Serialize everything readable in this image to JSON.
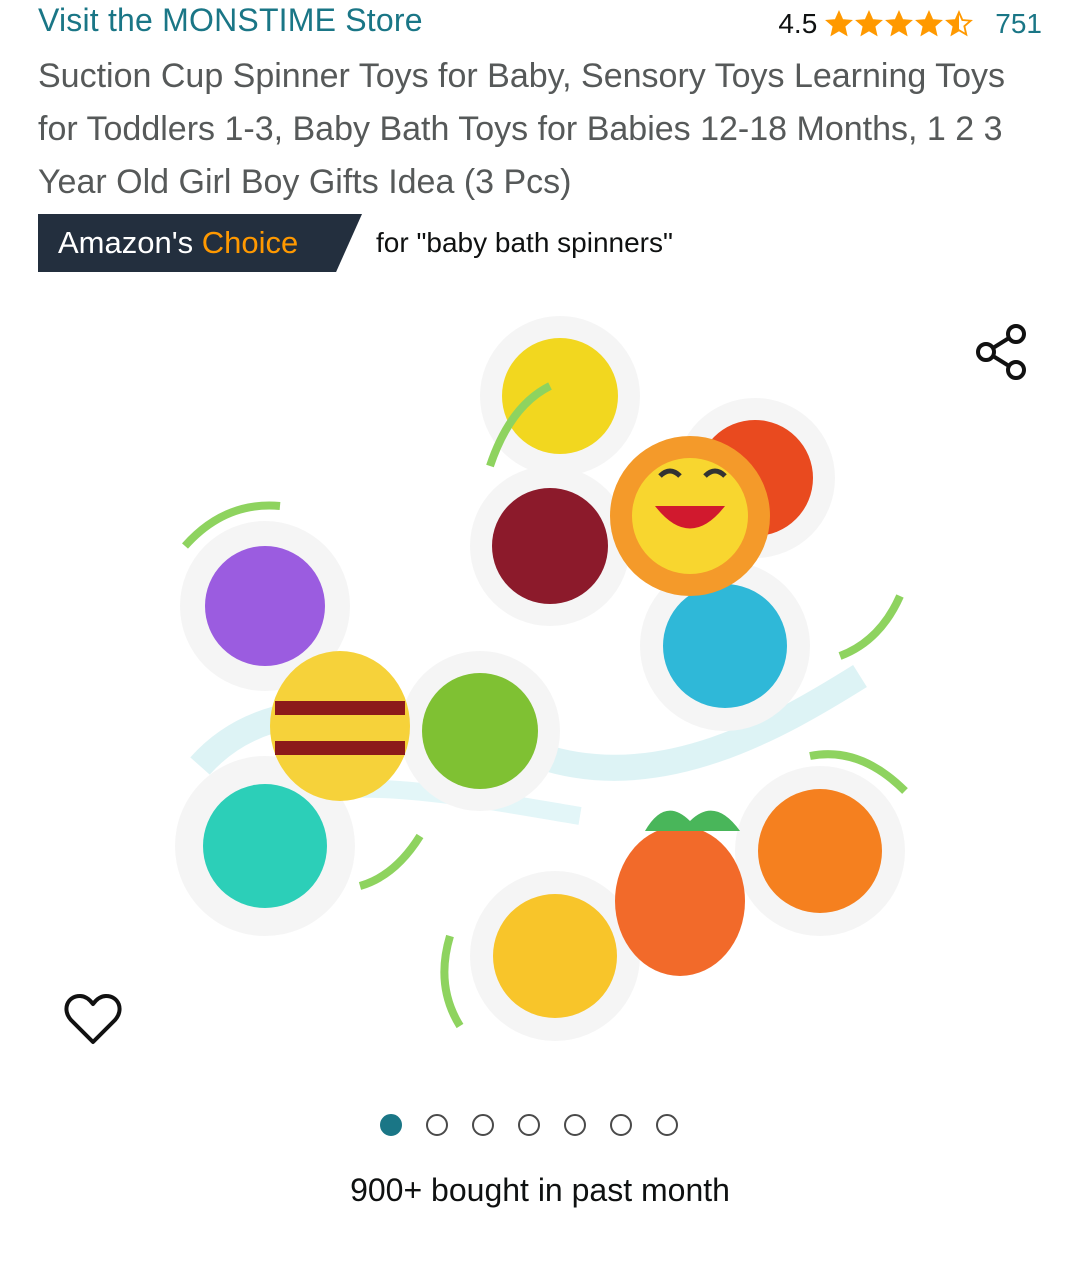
{
  "header": {
    "store_link": "Visit the MONSTIME Store",
    "rating_value": "4.5",
    "rating_stars": 4.5,
    "review_count": "751"
  },
  "product": {
    "title": "Suction Cup Spinner Toys for Baby, Sensory Toys Learning Toys for Toddlers 1-3, Baby Bath Toys for Babies 12-18 Months, 1 2 3 Year Old Girl Boy Gifts Idea (3 Pcs)"
  },
  "badge": {
    "prefix": "Amazon's",
    "highlight": "Choice",
    "for_text": "for \"baby bath spinners\""
  },
  "gallery": {
    "image_count": 7,
    "active_index": 1,
    "icons": {
      "share": "share-icon",
      "wishlist": "heart-icon"
    }
  },
  "social_proof": {
    "bought_text": "900+ bought in past month"
  },
  "colors": {
    "link": "#1a7686",
    "star": "#ff9900",
    "badge_bg": "#232f3e",
    "badge_highlight": "#ff9900"
  }
}
